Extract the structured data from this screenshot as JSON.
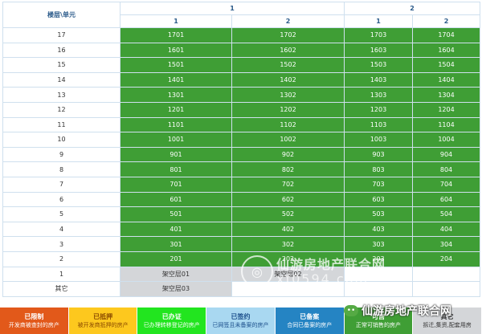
{
  "header": {
    "corner_label": "楼层\\单元",
    "units": [
      {
        "label": "1",
        "rooms": [
          "1",
          "2"
        ]
      },
      {
        "label": "2",
        "rooms": [
          "1",
          "2"
        ]
      }
    ]
  },
  "floors": [
    {
      "label": "17",
      "cells": [
        "1701",
        "1702",
        "1703",
        "1704"
      ]
    },
    {
      "label": "16",
      "cells": [
        "1601",
        "1602",
        "1603",
        "1604"
      ]
    },
    {
      "label": "15",
      "cells": [
        "1501",
        "1502",
        "1503",
        "1504"
      ]
    },
    {
      "label": "14",
      "cells": [
        "1401",
        "1402",
        "1403",
        "1404"
      ]
    },
    {
      "label": "13",
      "cells": [
        "1301",
        "1302",
        "1303",
        "1304"
      ]
    },
    {
      "label": "12",
      "cells": [
        "1201",
        "1202",
        "1203",
        "1204"
      ]
    },
    {
      "label": "11",
      "cells": [
        "1101",
        "1102",
        "1103",
        "1104"
      ]
    },
    {
      "label": "10",
      "cells": [
        "1001",
        "1002",
        "1003",
        "1004"
      ]
    },
    {
      "label": "9",
      "cells": [
        "901",
        "902",
        "903",
        "904"
      ]
    },
    {
      "label": "8",
      "cells": [
        "801",
        "802",
        "803",
        "804"
      ]
    },
    {
      "label": "7",
      "cells": [
        "701",
        "702",
        "703",
        "704"
      ]
    },
    {
      "label": "6",
      "cells": [
        "601",
        "602",
        "603",
        "604"
      ]
    },
    {
      "label": "5",
      "cells": [
        "501",
        "502",
        "503",
        "504"
      ]
    },
    {
      "label": "4",
      "cells": [
        "401",
        "402",
        "403",
        "404"
      ]
    },
    {
      "label": "3",
      "cells": [
        "301",
        "302",
        "303",
        "304"
      ]
    },
    {
      "label": "2",
      "cells": [
        "201",
        "202",
        "203",
        "204"
      ]
    },
    {
      "label": "1",
      "cells": [
        "架空层01",
        "架空层02",
        "",
        ""
      ],
      "status": [
        "other",
        "other",
        "empty",
        "empty"
      ]
    },
    {
      "label": "其它",
      "cells": [
        "架空层03",
        "",
        "",
        ""
      ],
      "status": [
        "other",
        "empty",
        "empty",
        "empty"
      ]
    }
  ],
  "colors": {
    "available": "#3f9e35",
    "other": "#d4d6d9",
    "empty": "#ffffff"
  },
  "legend": [
    {
      "title": "已限制",
      "desc": "开发商被查封的房产",
      "bg": "#e2591a",
      "fg": "#ffffff"
    },
    {
      "title": "已抵押",
      "desc": "被开发商抵押的房产",
      "bg": "#fdc81e",
      "fg": "#8a4a00"
    },
    {
      "title": "已办证",
      "desc": "已办理转移登记的房产",
      "bg": "#22e51f",
      "fg": "#ffffff"
    },
    {
      "title": "已签约",
      "desc": "已网签且未备案的房产",
      "bg": "#a9d8f1",
      "fg": "#1c4f8c"
    },
    {
      "title": "已备案",
      "desc": "合同已备案的房产",
      "bg": "#2584c3",
      "fg": "#ffffff"
    },
    {
      "title": "可售",
      "desc": "正常可销售的房产",
      "bg": "#3f9e35",
      "fg": "#ffffff"
    },
    {
      "title": "其它",
      "desc": "拆迁,集资,配套用房",
      "bg": "#d4d6d9",
      "fg": "#333333"
    }
  ],
  "watermark": {
    "name": "仙游房地产联合网",
    "url": "xf0594.com",
    "account": "仙游房地产联合网"
  }
}
